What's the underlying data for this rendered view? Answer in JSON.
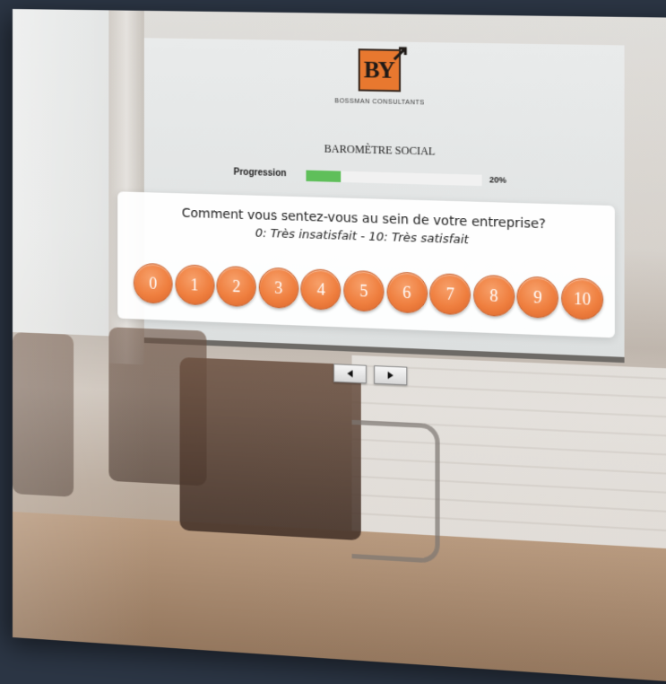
{
  "brand": {
    "logo_text": "BY",
    "logo_color": "#e8782f",
    "name": "BOSSMAN CONSULTANTS"
  },
  "survey": {
    "title": "BAROMÈTRE SOCIAL",
    "progress_label": "Progression",
    "progress_value": 0.2,
    "progress_text": "20%",
    "progress_color": "#5fbf5a"
  },
  "question": {
    "text": "Comment vous sentez-vous au sein de votre entreprise?",
    "hint": "0: Très insatisfait - 10: Très satisfait",
    "scale": [
      "0",
      "1",
      "2",
      "3",
      "4",
      "5",
      "6",
      "7",
      "8",
      "9",
      "10"
    ],
    "scale_color": "#ef7f3f"
  },
  "nav": {
    "prev_icon": "triangle-left-icon",
    "next_icon": "triangle-right-icon"
  }
}
